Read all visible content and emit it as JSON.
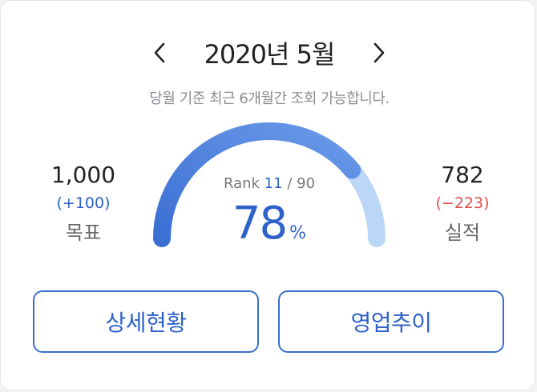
{
  "header": {
    "month_title": "2020년 5월",
    "prev_icon": "chevron-left-icon",
    "next_icon": "chevron-right-icon"
  },
  "subtitle": "당월 기준 최근 6개월간 조회 가능합니다.",
  "target": {
    "value": "1,000",
    "diff": "(+100)",
    "label": "목표"
  },
  "actual": {
    "value": "782",
    "diff": "(−223)",
    "label": "실적"
  },
  "gauge": {
    "rank_label": "Rank",
    "rank_value": "11",
    "rank_separator": "/",
    "rank_total": "90",
    "percent_value": "78",
    "percent_unit": "%",
    "fill_fraction": 0.78,
    "colors": {
      "fill_start": "#3b6fd4",
      "fill_end": "#6b9ae8",
      "track": "#bcd6f7",
      "positive": "#2e62c9",
      "negative": "#e34b4b"
    }
  },
  "buttons": {
    "detail_label": "상세현황",
    "trend_label": "영업추이"
  }
}
